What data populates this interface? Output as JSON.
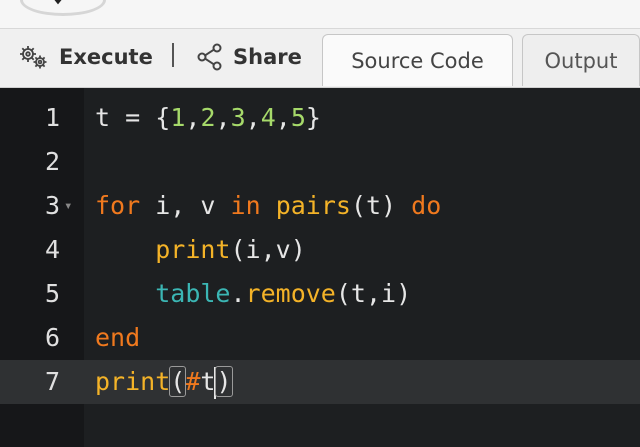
{
  "toolbar": {
    "execute_label": "Execute",
    "separator": "|",
    "share_label": "Share",
    "execute_icon": "gears-icon",
    "share_icon": "share-nodes-icon"
  },
  "tabs": [
    {
      "label": "Source Code",
      "active": true
    },
    {
      "label": "Output",
      "active": false
    }
  ],
  "editor": {
    "active_line": 7,
    "lines": [
      {
        "number": "1",
        "text": "t = {1,2,3,4,5}"
      },
      {
        "number": "2",
        "text": ""
      },
      {
        "number": "3",
        "text": "for i, v in pairs(t) do",
        "foldable": true
      },
      {
        "number": "4",
        "text": "    print(i,v)"
      },
      {
        "number": "5",
        "text": "    table.remove(t,i)"
      },
      {
        "number": "6",
        "text": "end"
      },
      {
        "number": "7",
        "text": "print(#t)"
      }
    ]
  },
  "colors": {
    "editor_bg": "#1d1f21",
    "keyword": "#f0791e",
    "function": "#f4b328",
    "number": "#a6d96a",
    "library": "#3bb6b4"
  }
}
